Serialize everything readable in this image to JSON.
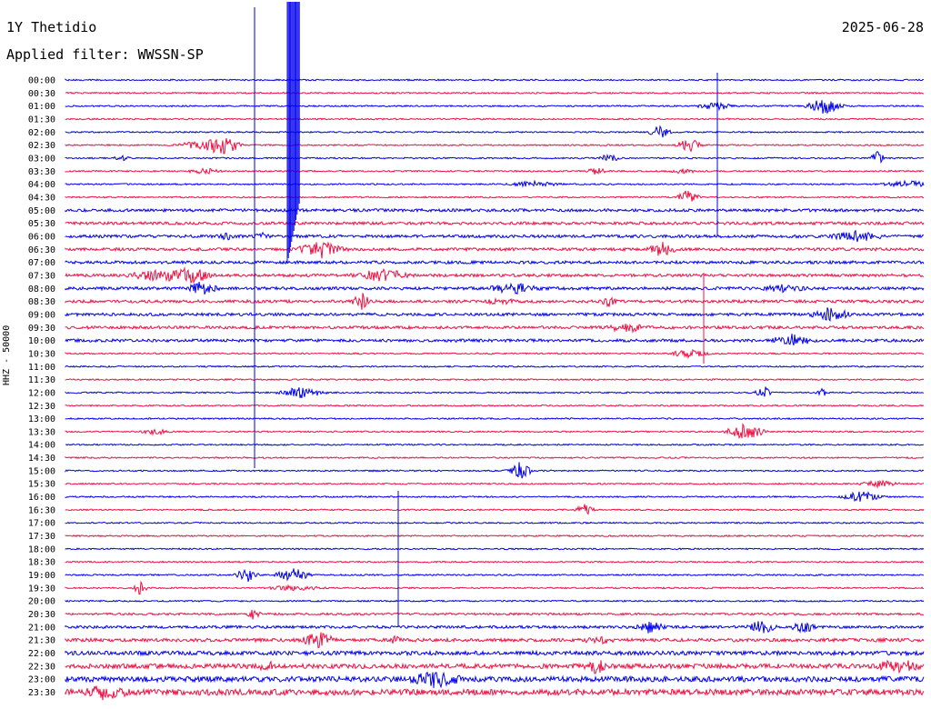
{
  "header": {
    "station": "1Y Thetidio",
    "date": "2025-06-28",
    "filter": "Applied filter: WWSSN-SP"
  },
  "colors": {
    "even_trace": "#0000ee",
    "odd_trace": "#ee1144"
  },
  "chart_data": {
    "type": "line",
    "ylabel": "HHZ - 50000",
    "rows": [
      "00:00",
      "00:30",
      "01:00",
      "01:30",
      "02:00",
      "02:30",
      "03:00",
      "03:30",
      "04:00",
      "04:30",
      "05:00",
      "05:30",
      "06:00",
      "06:30",
      "07:00",
      "07:30",
      "08:00",
      "08:30",
      "09:00",
      "09:30",
      "10:00",
      "10:30",
      "11:00",
      "11:30",
      "12:00",
      "12:30",
      "13:00",
      "13:30",
      "14:00",
      "14:30",
      "15:00",
      "15:30",
      "16:00",
      "16:30",
      "17:00",
      "17:30",
      "18:00",
      "18:30",
      "19:00",
      "19:30",
      "20:00",
      "20:30",
      "21:00",
      "21:30",
      "22:00",
      "22:30",
      "23:00",
      "23:30"
    ],
    "grid": false,
    "legend": "none"
  }
}
